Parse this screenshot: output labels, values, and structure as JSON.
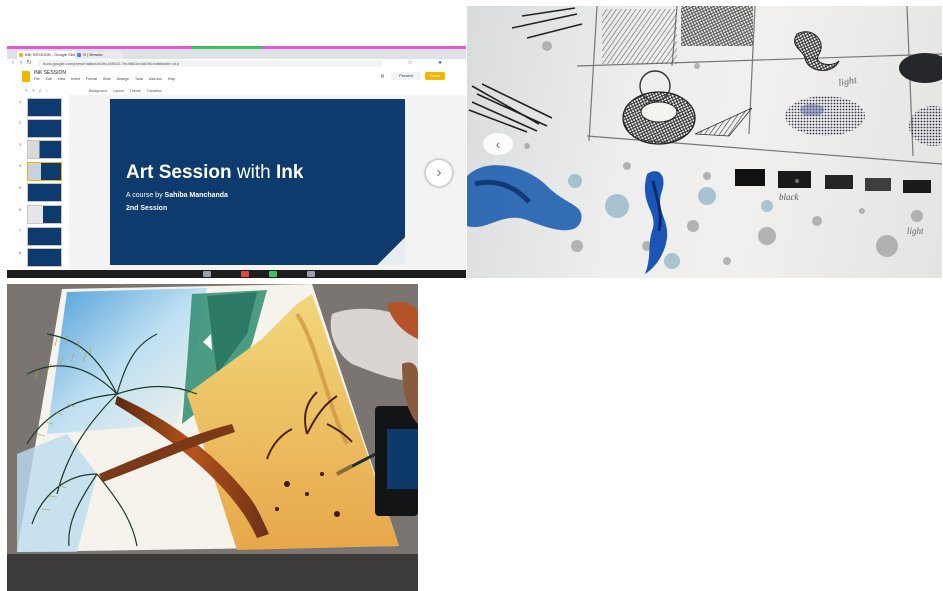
{
  "screen_share": {
    "tabs": [
      {
        "label": "INK SESSION - Google Slides",
        "favicon_color": "#f4b400"
      },
      {
        "label": "G | Browse",
        "favicon_color": "#4285f4"
      }
    ],
    "url": "docs.google.com/presentation/d/1bvJ4fEbD-Tbu5t6Gm3aSKk/edit#slide=id.p",
    "doc_title": "INK SESSION",
    "menu_items": [
      "File",
      "Edit",
      "View",
      "Insert",
      "Format",
      "Slide",
      "Arrange",
      "Tools",
      "Add-ons",
      "Help"
    ],
    "present_label": "Present",
    "share_label": "Share",
    "toolbar_items": [
      "Background",
      "Layout",
      "Theme",
      "Transition"
    ],
    "slide_numbers": [
      "1",
      "2",
      "3",
      "4",
      "5",
      "6",
      "7",
      "8",
      "9"
    ],
    "slide": {
      "title_prefix": "Art Session",
      "title_middle": " with ",
      "title_suffix": "Ink",
      "subtitle_prefix": "A course by ",
      "author": "Sahiba Manchanda",
      "session": "2nd Session",
      "background": "#0e3b6d"
    }
  },
  "ink_sheet": {
    "labels": {
      "light_top": "light",
      "black": "black",
      "light_bottom": "light"
    },
    "ink_color": "#1f5fb0",
    "nav_icon": "chevron-left-icon"
  },
  "painting": {
    "subject": "palm-trees-beach-watercolor"
  }
}
